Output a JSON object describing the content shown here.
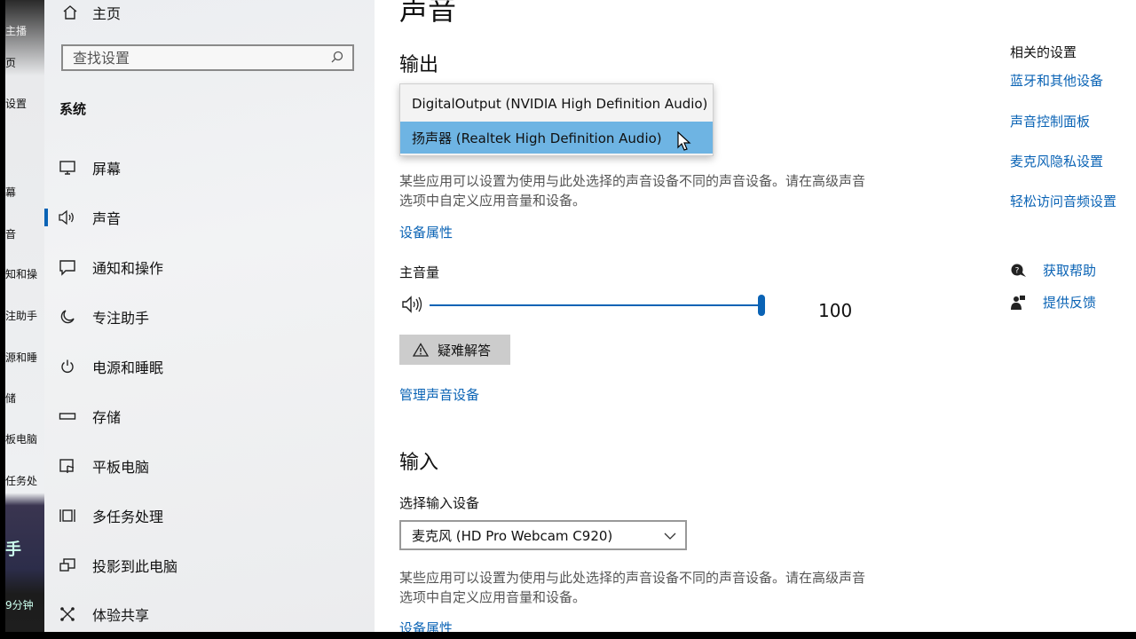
{
  "background_window": {
    "items": [
      "主播",
      "页",
      "设置",
      "幕",
      "音",
      "知和操",
      "注助手",
      "源和睡",
      "储",
      "板电脑",
      "任务处",
      "手",
      "9分钟"
    ]
  },
  "sidebar": {
    "home_label": "主页",
    "search_placeholder": "查找设置",
    "section_title": "系统",
    "items": [
      {
        "label": "屏幕",
        "icon": "monitor-icon"
      },
      {
        "label": "声音",
        "icon": "speaker-icon"
      },
      {
        "label": "通知和操作",
        "icon": "notification-icon"
      },
      {
        "label": "专注助手",
        "icon": "moon-icon"
      },
      {
        "label": "电源和睡眠",
        "icon": "power-icon"
      },
      {
        "label": "存储",
        "icon": "storage-icon"
      },
      {
        "label": "平板电脑",
        "icon": "tablet-icon"
      },
      {
        "label": "多任务处理",
        "icon": "multitask-icon"
      },
      {
        "label": "投影到此电脑",
        "icon": "project-icon"
      },
      {
        "label": "体验共享",
        "icon": "share-icon"
      }
    ],
    "active_index": 1
  },
  "main": {
    "title": "声音",
    "output": {
      "heading": "输出",
      "dropdown_options": [
        "DigitalOutput (NVIDIA High Definition Audio)",
        "扬声器 (Realtek High Definition Audio)"
      ],
      "selected_option_index": 1,
      "description": "某些应用可以设置为使用与此处选择的声音设备不同的声音设备。请在高级声音选项中自定义应用音量和设备。",
      "device_properties_link": "设备属性",
      "master_volume_label": "主音量",
      "volume_value": "100",
      "volume_level": 1.0,
      "troubleshoot_label": "疑难解答",
      "manage_devices_link": "管理声音设备"
    },
    "input": {
      "heading": "输入",
      "select_label": "选择输入设备",
      "selected_device": "麦克风 (HD Pro Webcam C920)",
      "description": "某些应用可以设置为使用与此处选择的声音设备不同的声音设备。请在高级声音选项中自定义应用音量和设备。",
      "device_properties_link": "设备属性"
    }
  },
  "related": {
    "title": "相关的设置",
    "links": [
      "蓝牙和其他设备",
      "声音控制面板",
      "麦克风隐私设置",
      "轻松访问音频设置"
    ],
    "help_label": "获取帮助",
    "feedback_label": "提供反馈"
  },
  "colors": {
    "accent": "#0a63b5",
    "selected_option_bg": "#6eb4e3"
  }
}
